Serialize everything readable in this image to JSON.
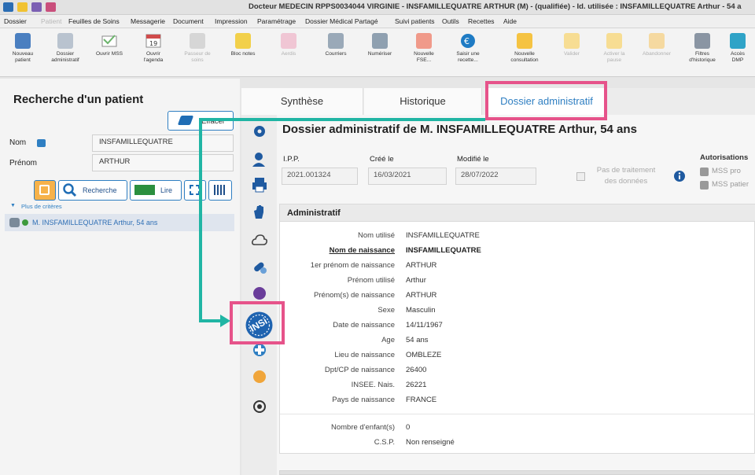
{
  "window": {
    "title": "Docteur MEDECIN RPPS0034044 VIRGINIE - INSFAMILLEQUATRE ARTHUR (M) - (qualifiée) - Id. utilisée : INSFAMILLEQUATRE Arthur - 54 a"
  },
  "menu": [
    "Dossier",
    "Patient",
    "Feuilles de Soins",
    "Messagerie",
    "Document",
    "Impression",
    "Paramétrage",
    "Dossier Médical Partagé",
    "Suivi patients",
    "Outils",
    "Recettes",
    "Aide"
  ],
  "toolbar": [
    {
      "label": "Nouveau\npatient"
    },
    {
      "label": "Dossier\nadministratif"
    },
    {
      "label": "Ouvrir MSS"
    },
    {
      "label": "Ouvrir\nl'agenda"
    },
    {
      "label": "Passeur de\nsoins"
    },
    {
      "label": "Bloc notes"
    },
    {
      "label": "Aerdis"
    },
    {
      "label": "Courriers"
    },
    {
      "label": "Numériser"
    },
    {
      "label": "Nouvelle\nFSE..."
    },
    {
      "label": "Saisir une\nrecette..."
    },
    {
      "label": "Nouvelle\nconsultation"
    },
    {
      "label": "Valider"
    },
    {
      "label": "Activer la\npause"
    },
    {
      "label": "Abandonner"
    },
    {
      "label": "Filtres\nd'historique"
    },
    {
      "label": "Accès\nDMP"
    }
  ],
  "search": {
    "title": "Recherche d'un patient",
    "clear_label": "Effacer",
    "nom_label": "Nom",
    "nom_value": "INSFAMILLEQUATRE",
    "prenom_label": "Prénom",
    "prenom_value": "ARTHUR",
    "recherche_label": "Recherche",
    "lire_label": "Lire",
    "more_criteria": "Plus de critères",
    "result": "M. INSFAMILLEQUATRE Arthur, 54 ans"
  },
  "tabs": [
    {
      "label": "Synthèse"
    },
    {
      "label": "Historique"
    },
    {
      "label": "Dossier administratif"
    }
  ],
  "dossier": {
    "heading": "Dossier administratif de M. INSFAMILLEQUATRE Arthur, 54 ans",
    "ipp_label": "I.P.P.",
    "ipp_value": "2021.001324",
    "cree_label": "Créé le",
    "cree_value": "16/03/2021",
    "modifie_label": "Modifié le",
    "modifie_value": "28/07/2022",
    "pas_traitement": "Pas de traitement\ndes données",
    "autorisations": "Autorisations",
    "mss_pro": "MSS pro",
    "mss_patient": "MSS patier"
  },
  "admin": {
    "header": "Administratif",
    "rows": [
      {
        "label": "Nom utilisé",
        "value": "INSFAMILLEQUATRE"
      },
      {
        "label": "Nom de naissance",
        "value": "INSFAMILLEQUATRE"
      },
      {
        "label": "1er prénom de naissance",
        "value": "ARTHUR"
      },
      {
        "label": "Prénom utilisé",
        "value": "Arthur"
      },
      {
        "label": "Prénom(s) de naissance",
        "value": "ARTHUR"
      },
      {
        "label": "Sexe",
        "value": "Masculin"
      },
      {
        "label": "Date de naissance",
        "value": "14/11/1967"
      },
      {
        "label": "Age",
        "value": "54 ans"
      },
      {
        "label": "Lieu de naissance",
        "value": "OMBLEZE"
      },
      {
        "label": "Dpt/CP de naissance",
        "value": "26400"
      },
      {
        "label": "INSEE. Nais.",
        "value": "26221"
      },
      {
        "label": "Pays de naissance",
        "value": "FRANCE"
      }
    ],
    "children_label": "Nombre d'enfant(s)",
    "children_value": "0",
    "csp_label": "C.S.P.",
    "csp_value": "Non renseigné"
  },
  "ins_badge": "INSi",
  "colors": {
    "annotation": "#e6538a",
    "arrow": "#20b5a4",
    "accent": "#2f7fc2"
  }
}
